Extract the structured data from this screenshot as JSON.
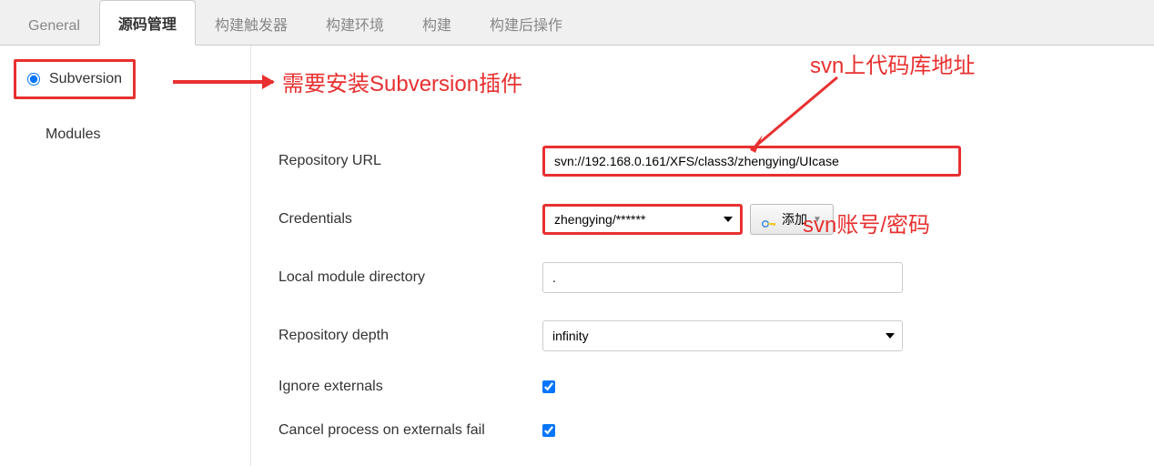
{
  "tabs": {
    "general": "General",
    "scm": "源码管理",
    "triggers": "构建触发器",
    "environment": "构建环境",
    "build": "构建",
    "post": "构建后操作"
  },
  "subversion": {
    "label": "Subversion",
    "checked": true
  },
  "modules": {
    "label": "Modules"
  },
  "form": {
    "repo_url": {
      "label": "Repository URL",
      "value": "svn://192.168.0.161/XFS/class3/zhengying/UIcase"
    },
    "credentials": {
      "label": "Credentials",
      "selected": "zhengying/******",
      "add_button": "添加"
    },
    "local_dir": {
      "label": "Local module directory",
      "value": "."
    },
    "depth": {
      "label": "Repository depth",
      "selected": "infinity"
    },
    "ignore_externals": {
      "label": "Ignore externals",
      "checked": true
    },
    "cancel_externals": {
      "label": "Cancel process on externals fail",
      "checked": true
    }
  },
  "annotations": {
    "install_plugin": "需要安装Subversion插件",
    "repo_address": "svn上代码库地址",
    "svn_account": "svn账号/密码"
  }
}
